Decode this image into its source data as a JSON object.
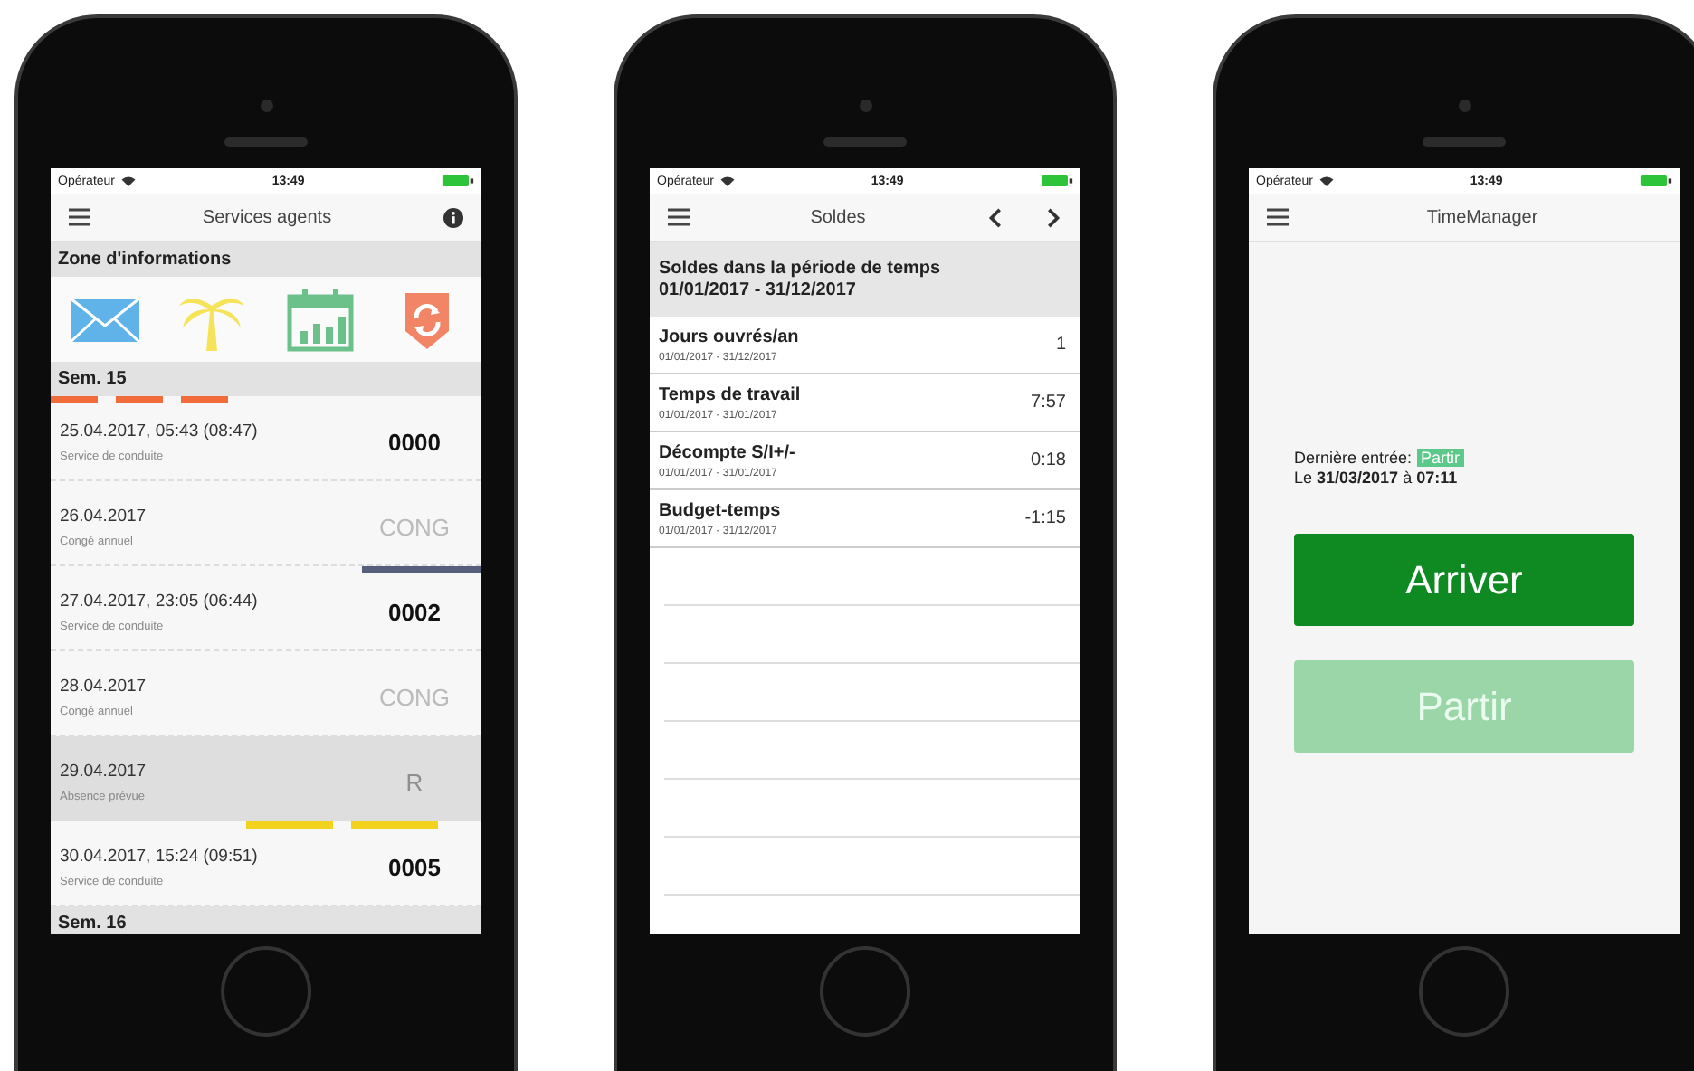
{
  "phones": [
    {
      "kind": "services",
      "status": {
        "carrier": "Opérateur",
        "time": "13:49"
      },
      "title": "Services agents",
      "zone": "Zone d'informations",
      "week": "Sem. 15",
      "days": [
        {
          "date": "25.04.2017, 05:43 (08:47)",
          "type": "Service de conduite",
          "code": "0000",
          "kind": "code",
          "selected": false,
          "marks": [
            {
              "color": "#f26b3a",
              "kind": "left"
            },
            {
              "color": "#f26b3a",
              "kind": "left"
            },
            {
              "color": "#f26b3a",
              "kind": "left"
            }
          ]
        },
        {
          "date": "26.04.2017",
          "type": "Congé annuel",
          "code": "CONG",
          "kind": "absence",
          "selected": false
        },
        {
          "date": "27.04.2017, 23:05 (06:44)",
          "type": "Service de conduite",
          "code": "0002",
          "kind": "code",
          "selected": false,
          "marks": [
            {
              "color": "#56607c",
              "kind": "right"
            }
          ]
        },
        {
          "date": "28.04.2017",
          "type": "Congé annuel",
          "code": "CONG",
          "kind": "absence",
          "selected": false
        },
        {
          "date": "29.04.2017",
          "type": "Absence prévue",
          "code": "R",
          "kind": "absence",
          "selected": true
        },
        {
          "date": "30.04.2017, 15:24 (09:51)",
          "type": "Service de conduite",
          "code": "0005",
          "kind": "code",
          "selected": false,
          "marks": [
            {
              "color": "#f2d21c",
              "kind": "center"
            },
            {
              "color": "#f2d21c",
              "kind": "center"
            }
          ]
        }
      ],
      "next_week": "Sem. 16"
    },
    {
      "kind": "balances",
      "status": {
        "carrier": "Opérateur",
        "time": "13:49"
      },
      "title": "Soldes",
      "heading": "Soldes dans la période de temps",
      "period": "01/01/2017 - 31/12/2017",
      "rows": [
        {
          "label": "Jours ouvrés/an",
          "period": "01/01/2017 - 31/12/2017",
          "value": "1"
        },
        {
          "label": "Temps de travail",
          "period": "01/01/2017 - 31/01/2017",
          "value": "7:57"
        },
        {
          "label": "Décompte S/I+/-",
          "period": "01/01/2017 - 31/01/2017",
          "value": "0:18"
        },
        {
          "label": "Budget-temps",
          "period": "01/01/2017 - 31/12/2017",
          "value": "-1:15"
        }
      ]
    },
    {
      "kind": "clock",
      "status": {
        "carrier": "Opérateur",
        "time": "13:49"
      },
      "title": "TimeManager",
      "last_label": "Dernière entrée:",
      "last_badge": "Partir",
      "last_line": "Le **31/03/2017** à **07:11**",
      "buttons": [
        {
          "label": "Arriver",
          "disabled": false
        },
        {
          "label": "Partir",
          "disabled": true
        }
      ]
    }
  ]
}
